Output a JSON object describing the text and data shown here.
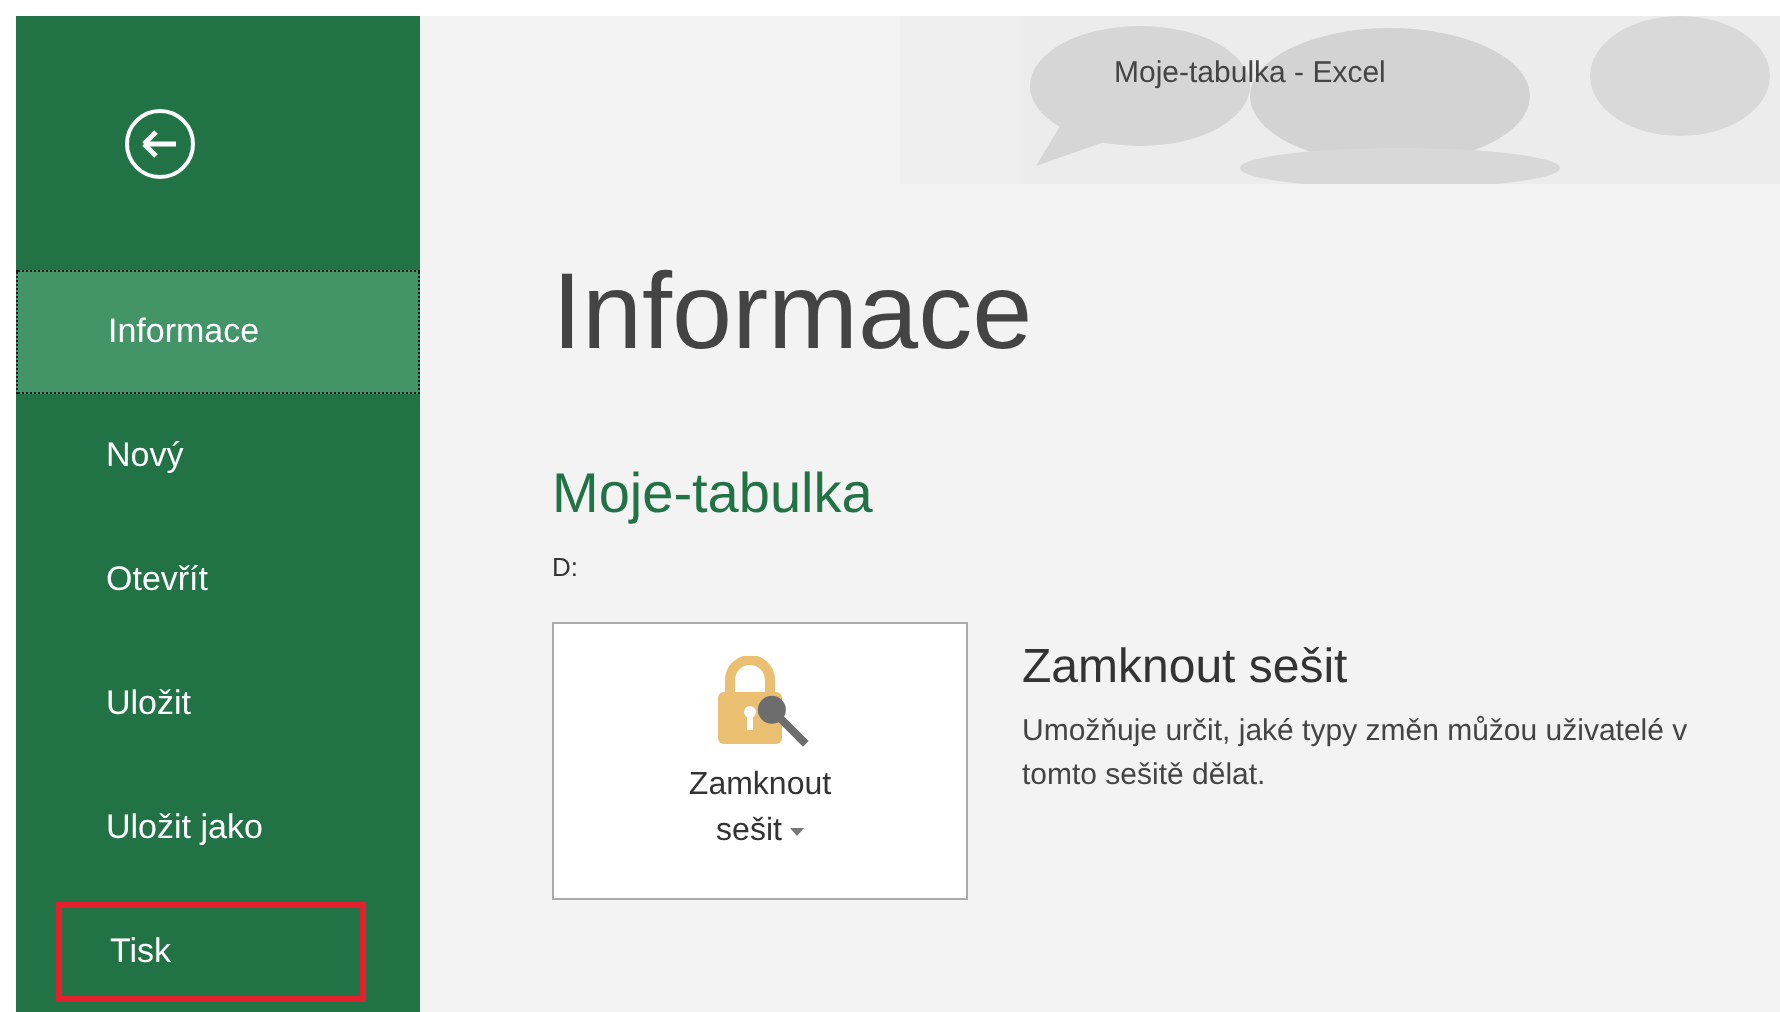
{
  "window": {
    "title": "Moje-tabulka  -  Excel"
  },
  "sidebar": {
    "items": [
      {
        "label": "Informace",
        "selected": true,
        "highlighted": false
      },
      {
        "label": "Nový",
        "selected": false,
        "highlighted": false
      },
      {
        "label": "Otevřít",
        "selected": false,
        "highlighted": false
      },
      {
        "label": "Uložit",
        "selected": false,
        "highlighted": false
      },
      {
        "label": "Uložit jako",
        "selected": false,
        "highlighted": false
      },
      {
        "label": "Tisk",
        "selected": false,
        "highlighted": true
      }
    ]
  },
  "page": {
    "heading": "Informace",
    "document_name": "Moje-tabulka",
    "path": "D:",
    "protect": {
      "button_line_1": "Zamknout",
      "button_line_2": "sešit",
      "title": "Zamknout sešit",
      "description": "Umožňuje určit, jaké typy změn můžou uživatelé v tomto sešitě dělat."
    }
  }
}
